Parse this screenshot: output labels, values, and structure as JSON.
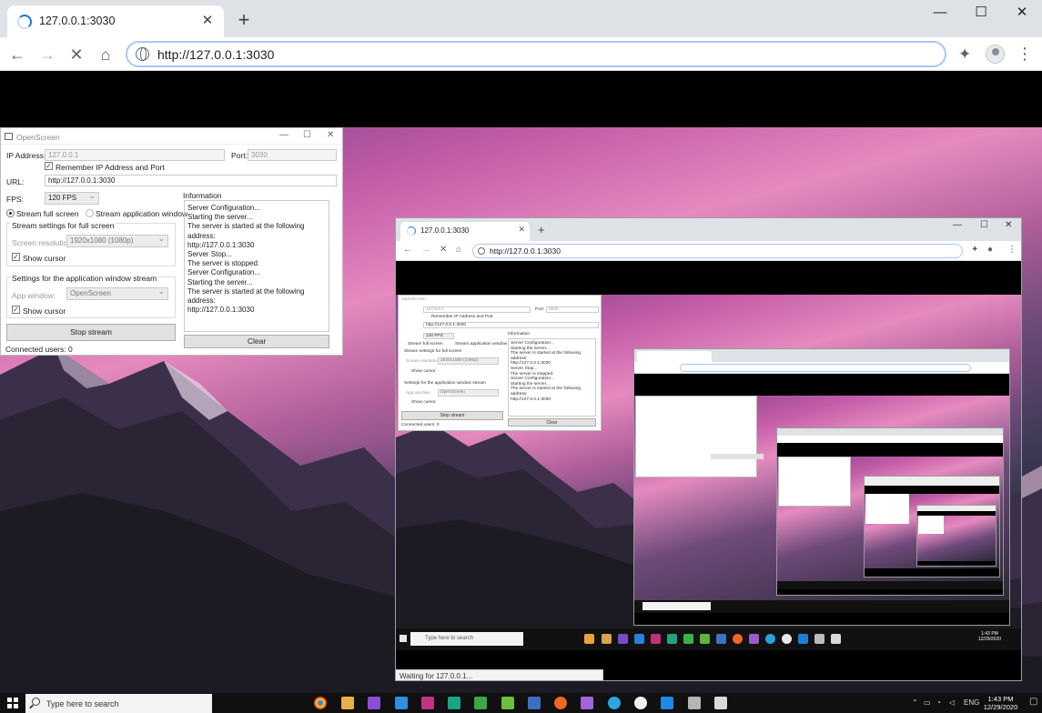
{
  "browser": {
    "tab_title": "127.0.0.1:3030",
    "close_tab": "✕",
    "new_tab": "+",
    "minimize": "—",
    "maximize": "☐",
    "close": "✕",
    "url": "http://127.0.0.1:3030",
    "back": "←",
    "forward": "→",
    "stop": "✕",
    "home": "⌂",
    "menu": "⋮"
  },
  "openscreen": {
    "title": "OpenScreen",
    "ip_label": "IP Address:",
    "ip_value": "127.0.0.1",
    "port_label": "Port:",
    "port_value": "3030",
    "remember_label": "Remember IP Address and Port",
    "url_label": "URL:",
    "url_value": "http://127.0.0.1:3030",
    "fps_label": "FPS:",
    "fps_value": "120 FPS",
    "stream_full": "Stream full screen",
    "stream_app": "Stream application window",
    "full_group": "Stream settings for full screen",
    "resolution_label": "Screen resolution:",
    "resolution_value": "1920x1080 (1080p)",
    "show_cursor": "Show cursor",
    "app_group": "Settings for the application window stream",
    "app_window_label": "App window:",
    "app_window_value": "OpenScreen",
    "stop_stream": "Stop stream",
    "connected_users": "Connected users: 0",
    "info_label": "Information",
    "log": [
      "Server Configuration...",
      "Starting the server...",
      "The server is started at the following address:",
      "http://127.0.0.1:3030",
      "Server Stop...",
      "The server is stopped.",
      "Server Configuration...",
      "Starting the server...",
      "The server is started at the following address:",
      "http://127.0.0.1:3030"
    ],
    "clear": "Clear"
  },
  "nested": {
    "tab_title": "127.0.0.1:3030",
    "url": "http://127.0.0.1:3030",
    "status": "Waiting for 127.0.0.1...",
    "search": "Type here to search",
    "time": "1:43 PM",
    "date": "12/29/2020",
    "os_title": "OpenScreen",
    "os_ip": "127.0.0.1",
    "os_port_label": "Port:",
    "os_port": "3030",
    "os_remember": "Remember IP Address and Port",
    "os_url": "http://127.0.0.1:3030",
    "os_fps": "120 FPS",
    "os_stream_full": "Stream full screen",
    "os_stream_app": "Stream application window",
    "os_full_group": "Stream settings for full screen",
    "os_resolution_label": "Screen resolution:",
    "os_resolution": "1920x1080 (1080p)",
    "os_show_cursor": "Show cursor",
    "os_app_group": "Settings for the application window stream",
    "os_app_window_label": "App window:",
    "os_app_window": "OpenScreen",
    "os_stop": "Stop stream",
    "os_users": "Connected users: 0",
    "os_info": "Information",
    "os_clear": "Clear"
  },
  "taskbar": {
    "search_placeholder": "Type here to search",
    "lang": "ENG",
    "time": "1:43 PM",
    "date": "12/29/2020"
  },
  "colors": {
    "accent": "#1a73e8",
    "taskbar": "#101010"
  }
}
